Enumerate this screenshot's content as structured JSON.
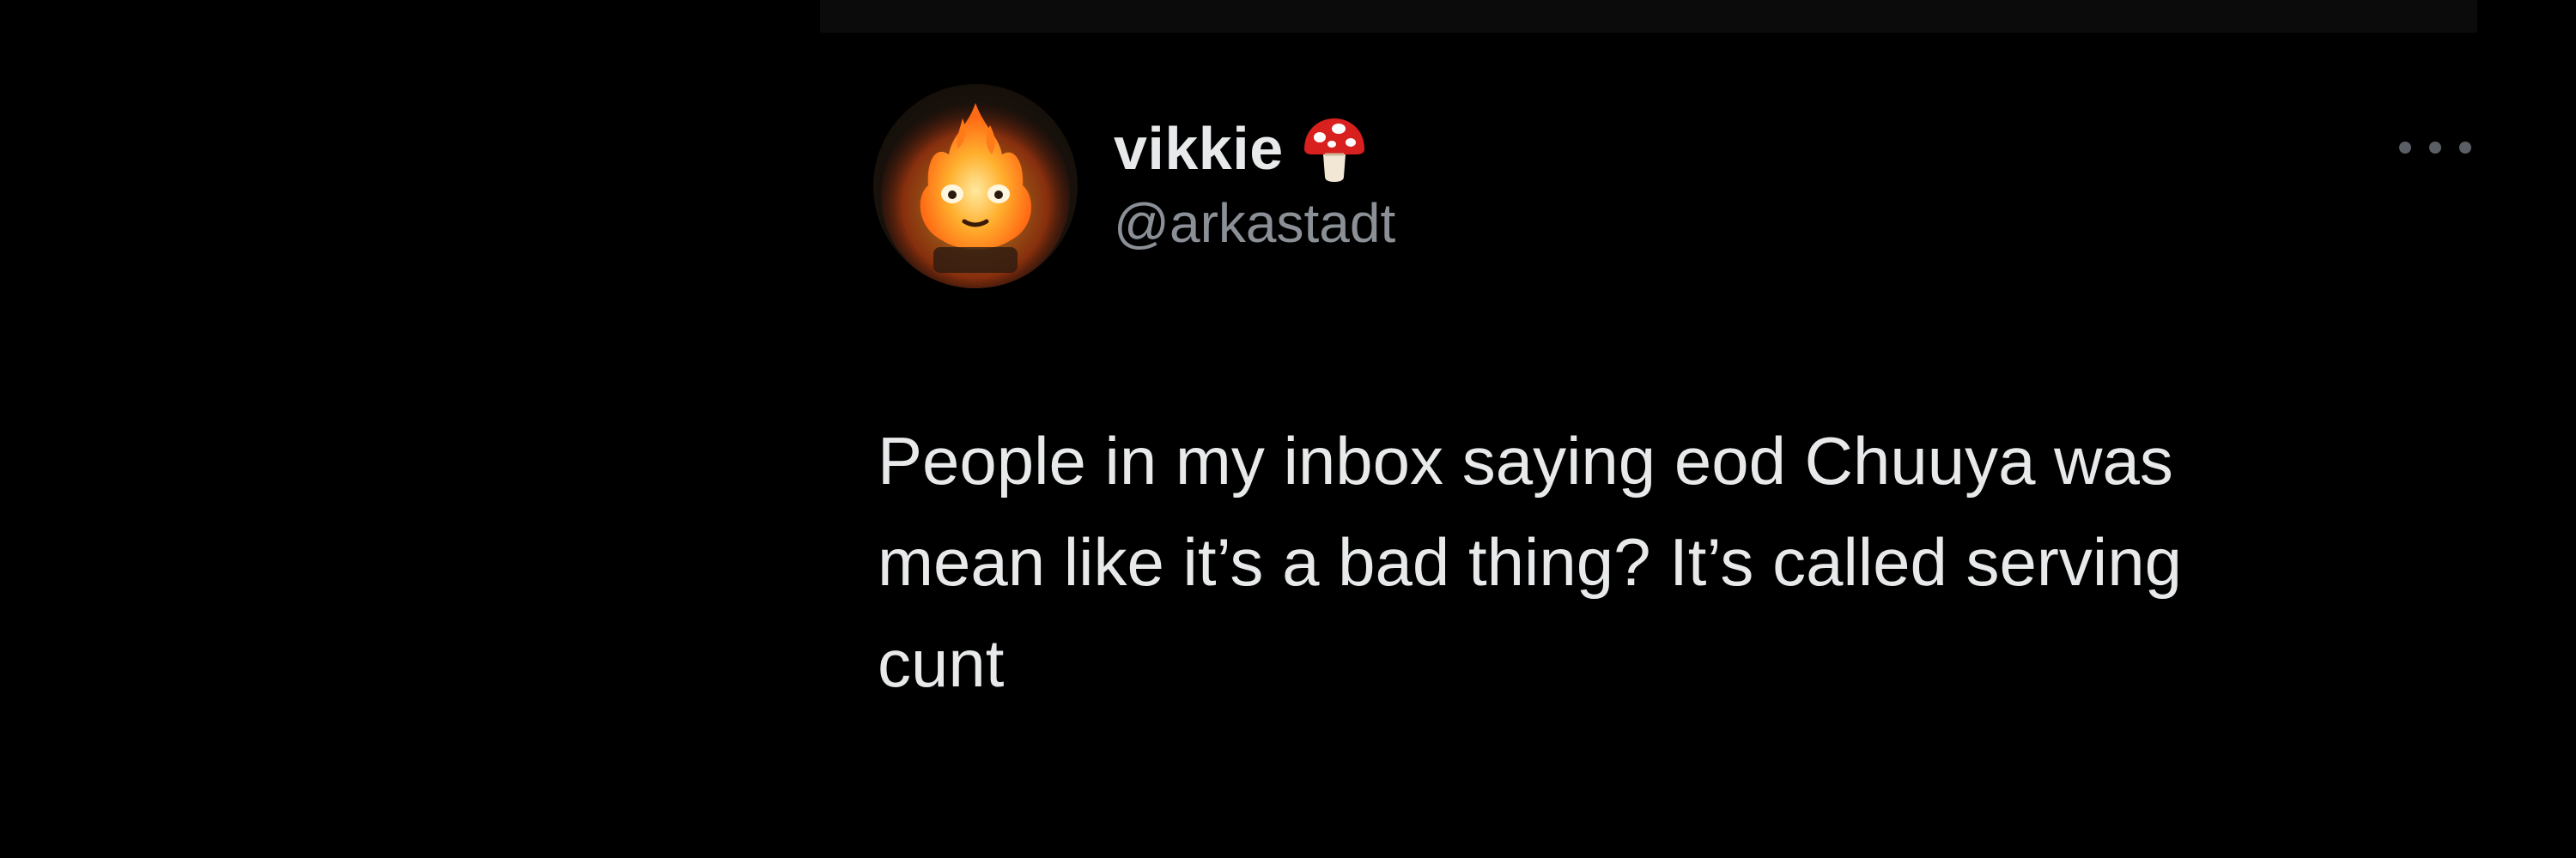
{
  "tweet": {
    "author": {
      "display_name": "vikkie",
      "handle": "@arkastadt",
      "avatar_icon": "calcifer-fire-avatar",
      "badge_icon": "mushroom-emoji-icon"
    },
    "more_icon": "more-horizontal-icon",
    "text": "People in my inbox saying eod Chuuya was\nmean like it’s a bad thing? It’s called serving\ncunt"
  },
  "colors": {
    "background": "#000000",
    "text_primary": "#e7e9ea",
    "text_secondary": "#8b9097",
    "mushroom_cap": "#d8201e"
  }
}
